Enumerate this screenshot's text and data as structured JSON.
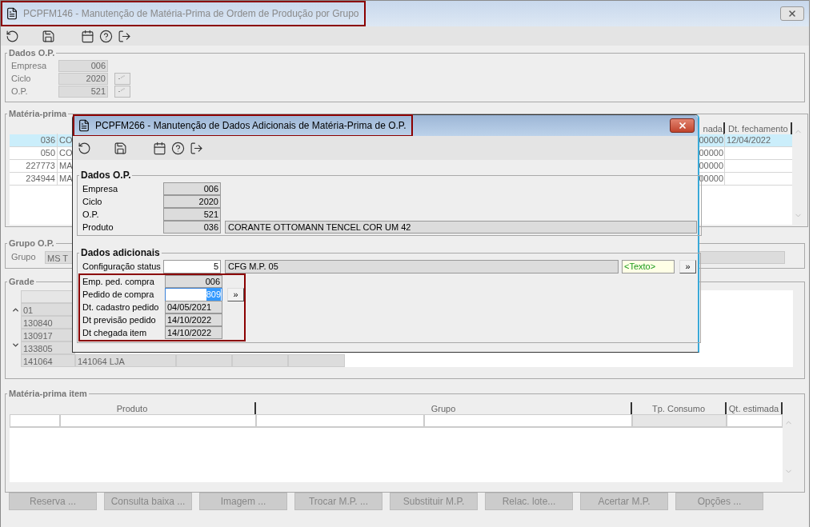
{
  "main_window": {
    "title": "PCPFM146 - Manutenção de Matéria-Prima de Ordem de Produção por Grupo",
    "toolbar": [
      {
        "kind": "undo"
      },
      {
        "kind": "save"
      },
      {
        "kind": "calendar"
      },
      {
        "kind": "help"
      },
      {
        "kind": "exit"
      }
    ],
    "dados_op": {
      "title": "Dados O.P.",
      "fields": [
        {
          "label": "Empresa",
          "value": "006",
          "has_button": false
        },
        {
          "label": "Ciclo",
          "value": "2020",
          "has_button": true
        },
        {
          "label": "O.P.",
          "value": "521",
          "has_button": true
        }
      ]
    },
    "materia_prima": {
      "title": "Matéria-prima",
      "columns": [
        "nada",
        "Dt. fechamento"
      ],
      "rows": [
        {
          "code": "036",
          "text": "CO",
          "qty": "00000",
          "date": "12/04/2022",
          "selected": true
        },
        {
          "code": "050",
          "text": "CO",
          "qty": "00000",
          "date": "",
          "selected": false
        },
        {
          "code": "227773",
          "text": "MA",
          "qty": "00000",
          "date": "",
          "selected": false
        },
        {
          "code": "234944",
          "text": "MA",
          "qty": "00000",
          "date": "",
          "selected": false
        }
      ]
    },
    "grupo_op": {
      "title": "Grupo O.P.",
      "label": "Grupo",
      "value": "MS T"
    },
    "grade": {
      "title": "Grade",
      "rows": [
        {
          "code": "01"
        },
        {
          "code": "130840"
        },
        {
          "code": "130917"
        },
        {
          "code": "133805"
        },
        {
          "code": "141064",
          "name": "141064 LJA"
        }
      ]
    },
    "item_table": {
      "title": "Matéria-prima item",
      "columns": [
        "Produto",
        "Grupo",
        "Tp. Consumo",
        "Qt. estimada"
      ]
    },
    "buttons": [
      "Reserva ...",
      "Consulta baixa ...",
      "Imagem ...",
      "Trocar M.P. ...",
      "Substituir M.P.",
      "Relac. lote...",
      "Acertar M.P.",
      "Opções ..."
    ]
  },
  "dialog": {
    "title": "PCPFM266 - Manutenção de Dados Adicionais de Matéria-Prima de O.P.",
    "toolbar": [
      {
        "kind": "undo"
      },
      {
        "kind": "save"
      },
      {
        "kind": "calendar"
      },
      {
        "kind": "help"
      },
      {
        "kind": "exit"
      }
    ],
    "dados_op": {
      "title": "Dados O.P.",
      "fields": [
        {
          "label": "Empresa",
          "value": "006"
        },
        {
          "label": "Ciclo",
          "value": "2020"
        },
        {
          "label": "O.P.",
          "value": "521"
        },
        {
          "label": "Produto",
          "value": "036",
          "description": "CORANTE OTTOMANN TENCEL COR UM 42"
        }
      ]
    },
    "dados_adicionais": {
      "title": "Dados adicionais",
      "config": {
        "label": "Configuração status",
        "value": "5",
        "description": "CFG M.P. 05",
        "text_field": "<Texto>",
        "button": "»"
      },
      "fields": [
        {
          "label": "Emp. ped. compra",
          "value": "006",
          "kind": "readonly_code"
        },
        {
          "label": "Pedido de compra",
          "value": "809",
          "kind": "input",
          "selected": true,
          "button": "»"
        },
        {
          "label": "Dt. cadastro pedido",
          "value": "04/05/2021",
          "kind": "readonly_date"
        },
        {
          "label": "Dt previsão pedido",
          "value": "14/10/2022",
          "kind": "readonly_date"
        },
        {
          "label": "Dt chegada item",
          "value": "14/10/2022",
          "kind": "readonly_date"
        }
      ]
    }
  }
}
